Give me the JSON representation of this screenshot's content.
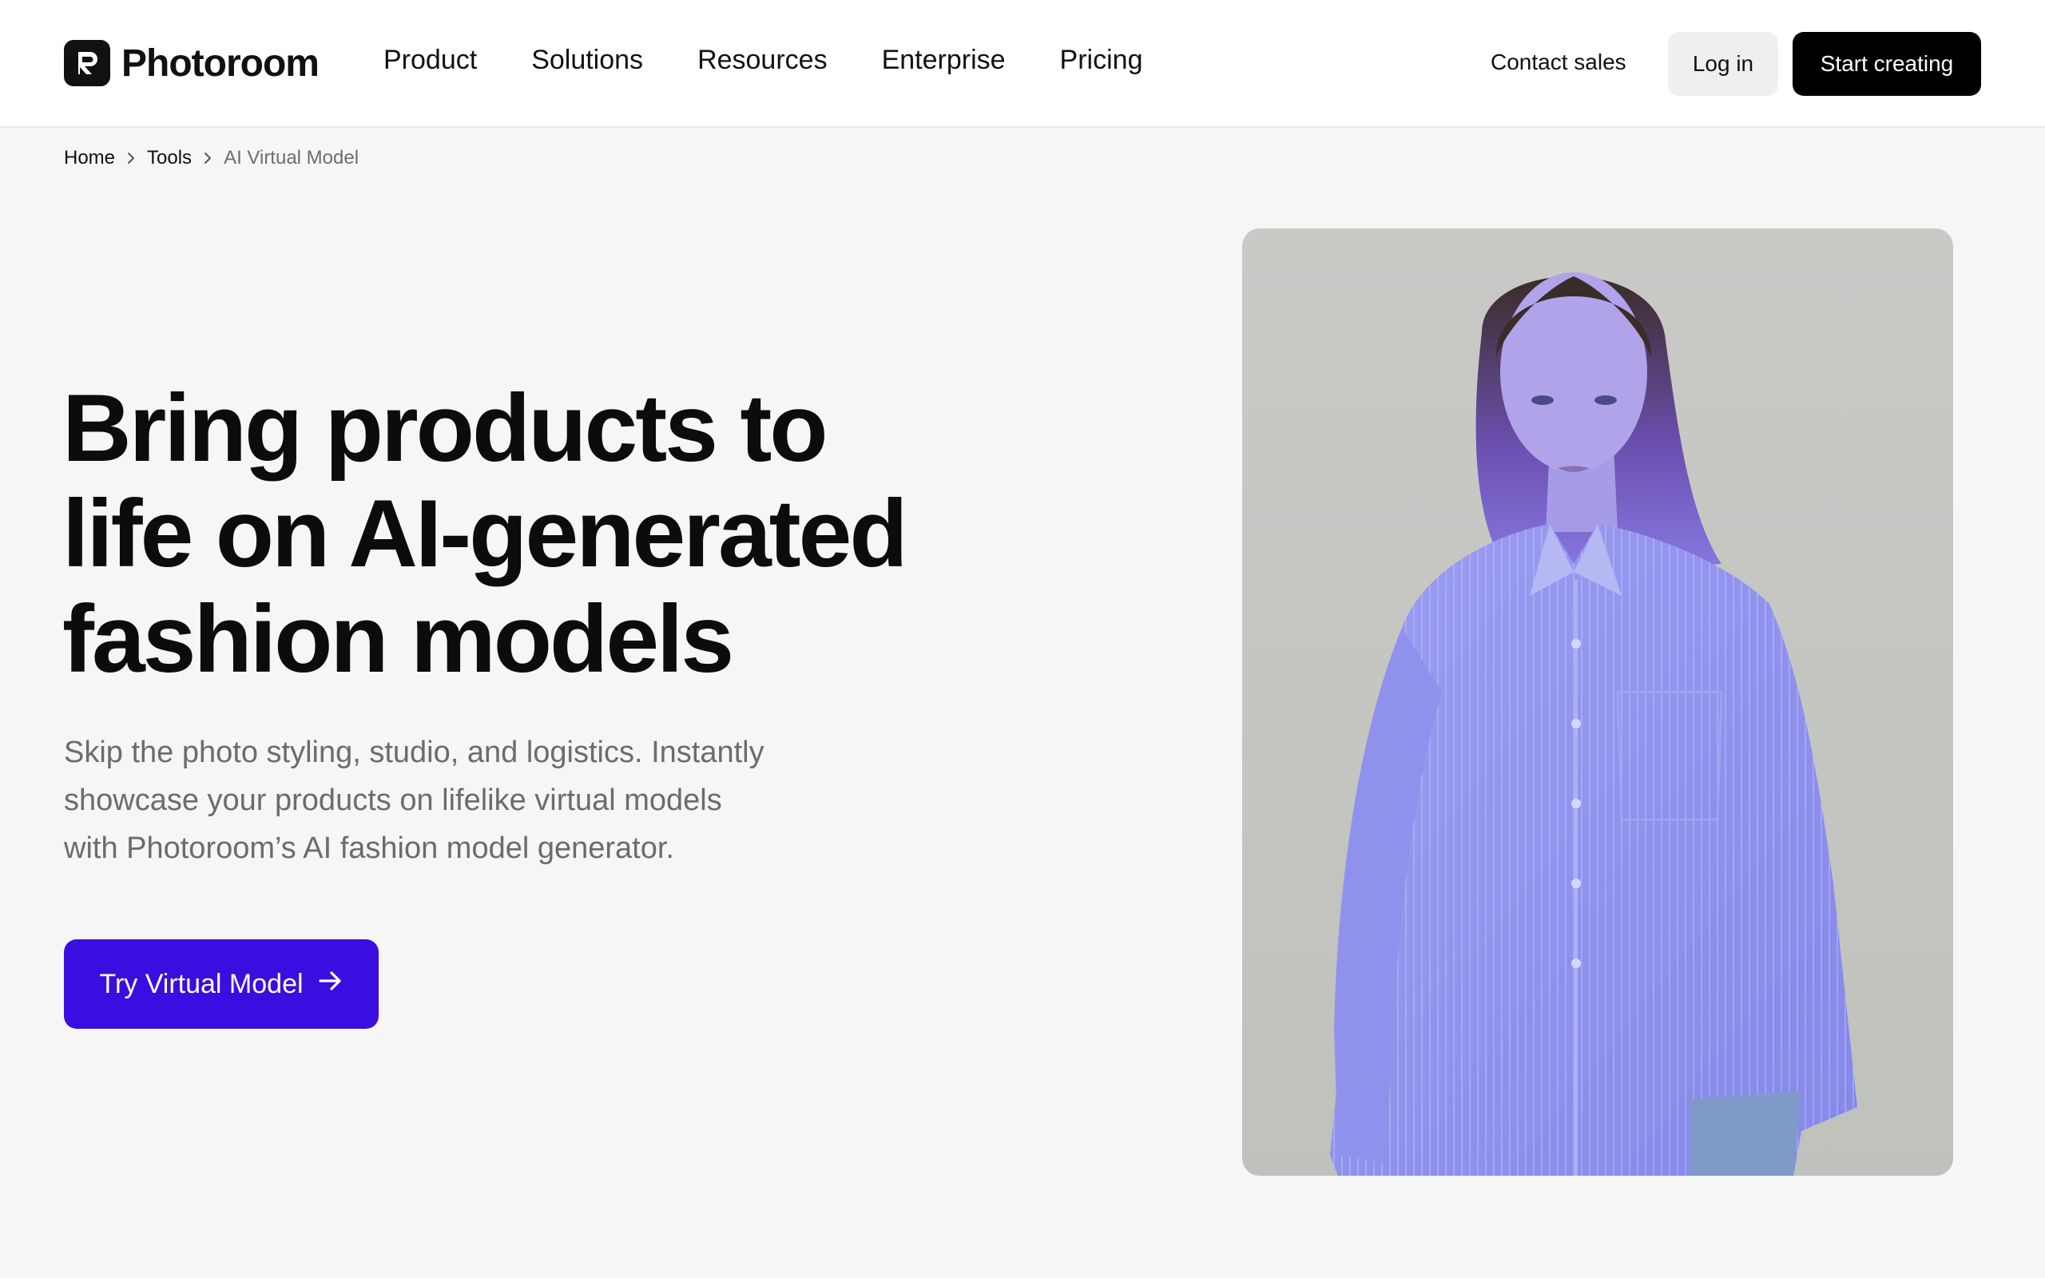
{
  "brand": {
    "name": "Photoroom"
  },
  "nav": {
    "items": [
      {
        "label": "Product"
      },
      {
        "label": "Solutions"
      },
      {
        "label": "Resources"
      },
      {
        "label": "Enterprise"
      },
      {
        "label": "Pricing"
      }
    ]
  },
  "header_actions": {
    "contact_sales": "Contact sales",
    "log_in": "Log in",
    "start_creating": "Start creating"
  },
  "breadcrumb": {
    "items": [
      {
        "label": "Home"
      },
      {
        "label": "Tools"
      },
      {
        "label": "AI Virtual Model"
      }
    ]
  },
  "hero": {
    "title_lines": [
      "Bring products to",
      "life on AI-generated",
      "fashion models"
    ],
    "subtitle_lines": [
      "Skip the photo styling, studio, and logistics. Instantly",
      "showcase your products on lifelike virtual models",
      "with Photoroom’s AI fashion model generator."
    ],
    "cta_label": "Try Virtual Model"
  },
  "colors": {
    "accent": "#3a0ee0",
    "page_background": "#f6f6f6",
    "header_background": "#ffffff",
    "button_dark": "#000000"
  },
  "icons": {
    "breadcrumb_separator": "chevron-right-icon",
    "cta_arrow": "arrow-right-icon",
    "logo": "photoroom-logo-icon"
  }
}
